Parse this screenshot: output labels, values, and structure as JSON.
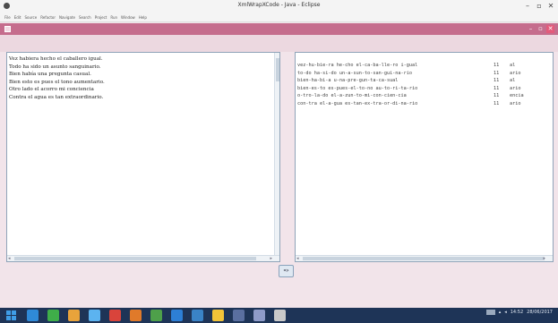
{
  "window": {
    "title": "XmlWrapXCode - Java - Eclipse",
    "controls": [
      "–",
      "▫",
      "✕"
    ]
  },
  "menu": [
    "File",
    "Edit",
    "Source",
    "Refactor",
    "Navigate",
    "Search",
    "Project",
    "Run",
    "Window",
    "Help"
  ],
  "app": {
    "controls": [
      "–",
      "▫",
      "✕"
    ]
  },
  "left_panel": {
    "lines": [
      "Vez habiera hecho el caballero igual.",
      "Todo ha sido un asunto sanguinario.",
      "Bien había una pregunta casual.",
      "Bien esto es pues el tono aumentario.",
      "Otro lado el acorro mi conciencia",
      "Contra el agua es tan extraordinario."
    ]
  },
  "right_panel": {
    "rows": [
      {
        "syllables": "vez-hu-bie-ra he-cho el-ca-ba-lle-ro i-gual",
        "count": "11",
        "rhyme": "al"
      },
      {
        "syllables": "to-do ha-si-do un-a-sun-to-san-gui-na-rio",
        "count": "11",
        "rhyme": "ario"
      },
      {
        "syllables": "bien-ha-bi-a u-na-pre-gun-ta-ca-sual",
        "count": "11",
        "rhyme": "al"
      },
      {
        "syllables": "bien-es-to es-pues-el-to-no au-to-ri-ta-rio",
        "count": "11",
        "rhyme": "ario"
      },
      {
        "syllables": "o-tro-la-do el-a-zun-to-mi-con-cien-cia",
        "count": "11",
        "rhyme": "encia"
      },
      {
        "syllables": "con-tra el-a-gua es-tan-ex-tra-or-di-na-rio",
        "count": "11",
        "rhyme": "ario"
      }
    ]
  },
  "convert_button": {
    "label": "=>"
  },
  "taskbar": {
    "icon_colors": [
      "#2f8ad8",
      "#3fae49",
      "#e8a33b",
      "#5cb3f0",
      "#d9443b",
      "#e07a2a",
      "#4ea04a",
      "#2d7fd6",
      "#3a83c6",
      "#f2c338",
      "#5a6fa0",
      "#8e9bc9",
      "#c9c9c9"
    ],
    "tray_time": "14:52",
    "tray_date": "28/06/2017"
  }
}
